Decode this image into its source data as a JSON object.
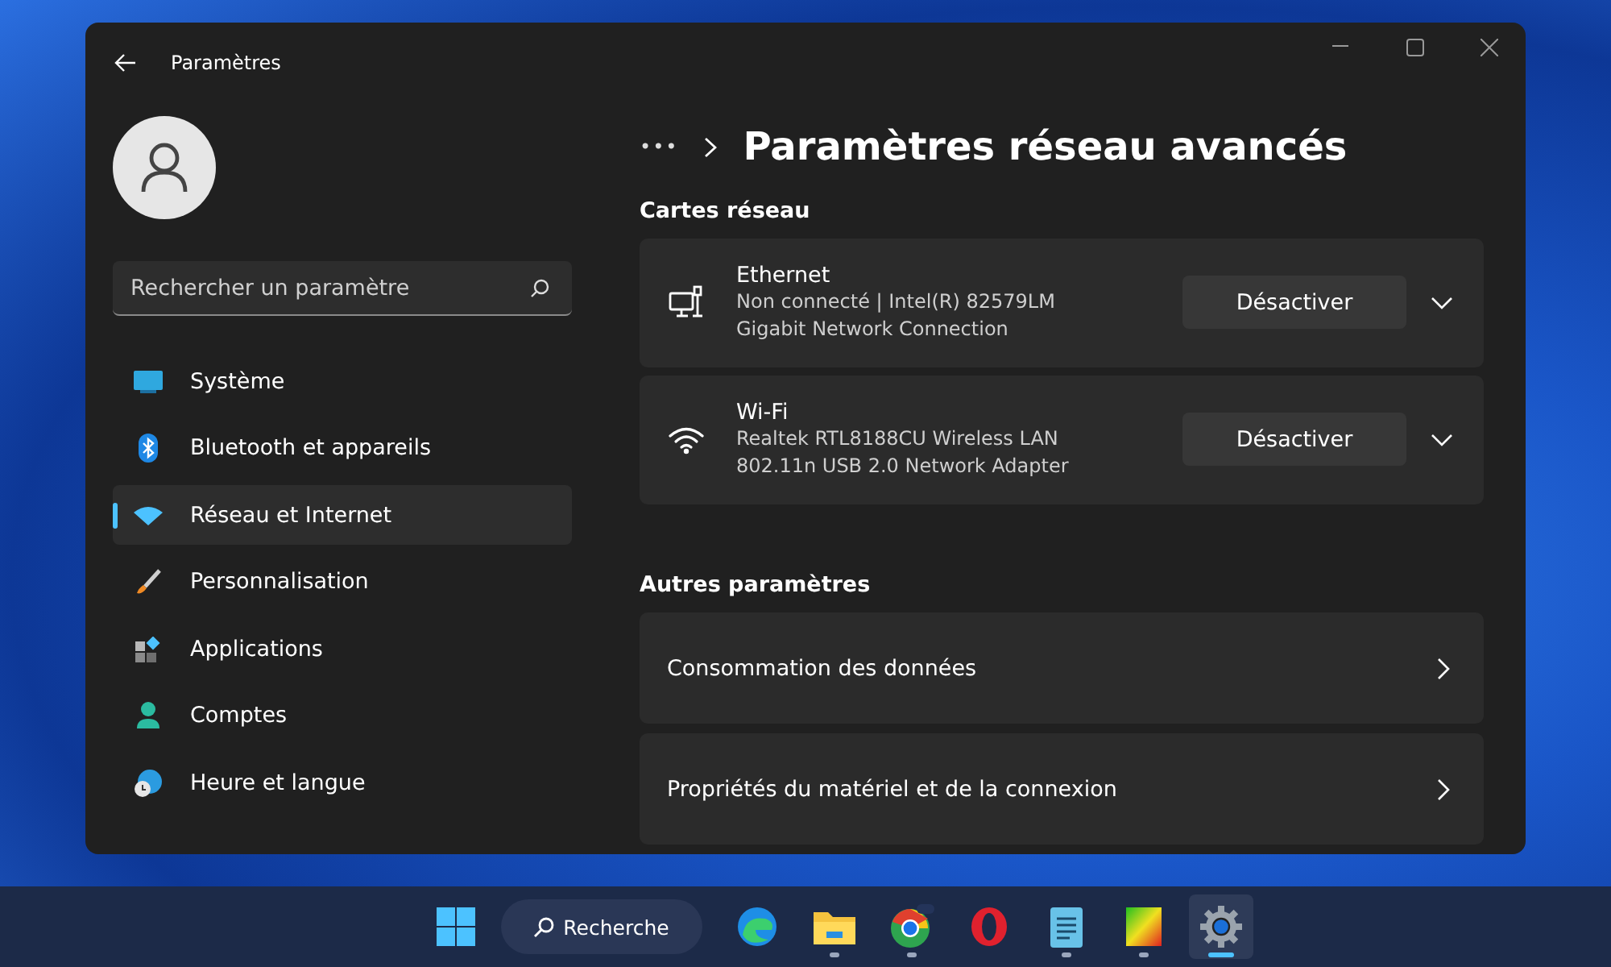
{
  "window": {
    "title": "Paramètres"
  },
  "search": {
    "placeholder": "Rechercher un paramètre"
  },
  "sidebar": {
    "items": [
      {
        "label": "Système",
        "kind": "system",
        "selected": false
      },
      {
        "label": "Bluetooth et appareils",
        "kind": "bluetooth",
        "selected": false
      },
      {
        "label": "Réseau et Internet",
        "kind": "network",
        "selected": true
      },
      {
        "label": "Personnalisation",
        "kind": "brush",
        "selected": false
      },
      {
        "label": "Applications",
        "kind": "apps",
        "selected": false
      },
      {
        "label": "Comptes",
        "kind": "account",
        "selected": false
      },
      {
        "label": "Heure et langue",
        "kind": "time",
        "selected": false
      }
    ]
  },
  "breadcrumb": {
    "ellipsis": "•••",
    "title": "Paramètres réseau avancés"
  },
  "adapters_section": {
    "heading": "Cartes réseau",
    "adapters": [
      {
        "kind": "ethernet",
        "name": "Ethernet",
        "description": "Non connecté | Intel(R) 82579LM Gigabit Network Connection",
        "button": "Désactiver",
        "expanded": false
      },
      {
        "kind": "wifi",
        "name": "Wi-Fi",
        "description": "Realtek RTL8188CU Wireless LAN 802.11n USB 2.0 Network Adapter",
        "button": "Désactiver",
        "expanded": false
      }
    ]
  },
  "other_section": {
    "heading": "Autres paramètres",
    "rows": [
      {
        "label": "Consommation des données"
      },
      {
        "label": "Propriétés du matériel et de la connexion"
      }
    ]
  },
  "taskbar": {
    "search_label": "Recherche",
    "apps": [
      {
        "kind": "edge",
        "running": false,
        "active": false
      },
      {
        "kind": "folder",
        "running": true,
        "active": false
      },
      {
        "kind": "chrome",
        "running": true,
        "active": false
      },
      {
        "kind": "opera",
        "running": false,
        "active": false
      },
      {
        "kind": "notepad",
        "running": true,
        "active": false
      },
      {
        "kind": "photo",
        "running": true,
        "active": false
      },
      {
        "kind": "settings",
        "running": true,
        "active": true
      }
    ]
  }
}
